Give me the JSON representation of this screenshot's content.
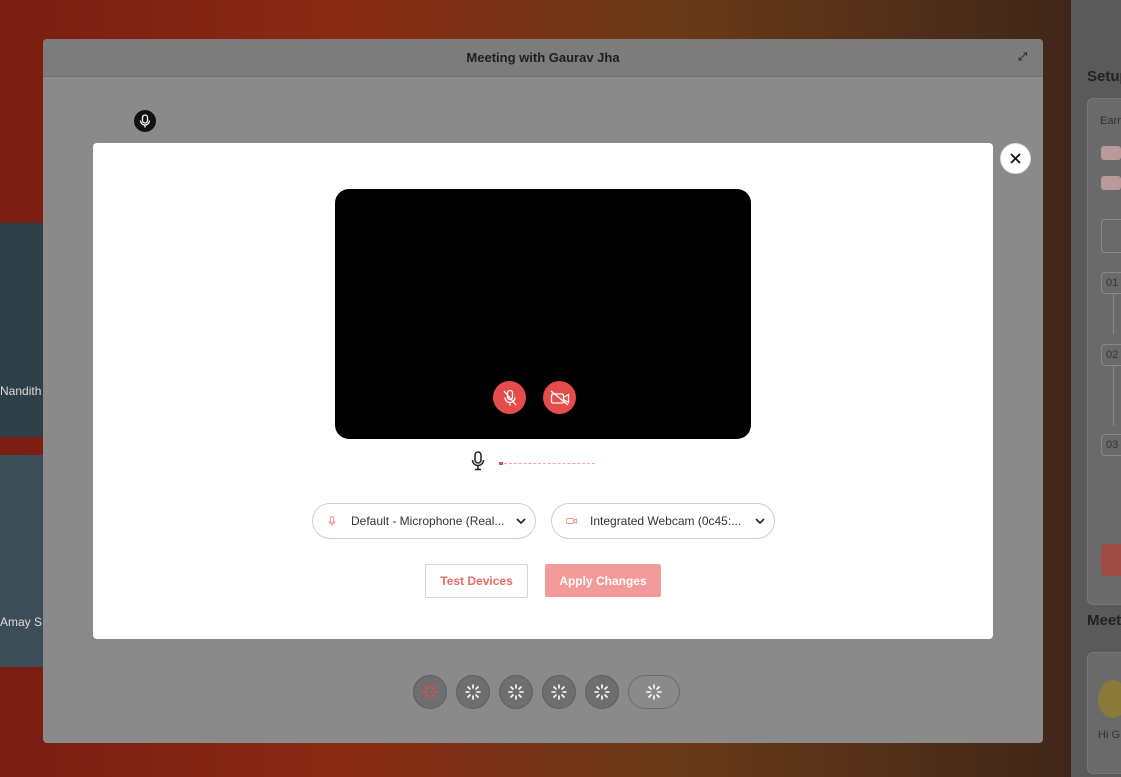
{
  "meeting": {
    "title": "Meeting with Gaurav Jha"
  },
  "background": {
    "participants": [
      "Nandith",
      "Amay S"
    ],
    "side_panel": {
      "heading_setup": "Setup",
      "heading_meetings": "Meet",
      "earn_text": "Earn",
      "step_numbers": [
        "01",
        "02",
        "03"
      ],
      "chat_preview": "Hi G"
    }
  },
  "device_modal": {
    "audio_select": "Default - Microphone (Real...",
    "video_select": "Integrated Webcam (0c45:...",
    "test_button": "Test Devices",
    "apply_button": "Apply Changes",
    "mic_level": 0.04
  },
  "colors": {
    "accent": "#e74c4c",
    "apply_disabled": "#f29999",
    "test_text": "#e86a6a"
  },
  "icons": {
    "close": "close-icon",
    "mic_off": "mic-off-icon",
    "camera_off": "camera-off-icon",
    "mic": "microphone-icon",
    "chevron": "chevron-down-icon",
    "loading": "loading-spinner-icon"
  }
}
